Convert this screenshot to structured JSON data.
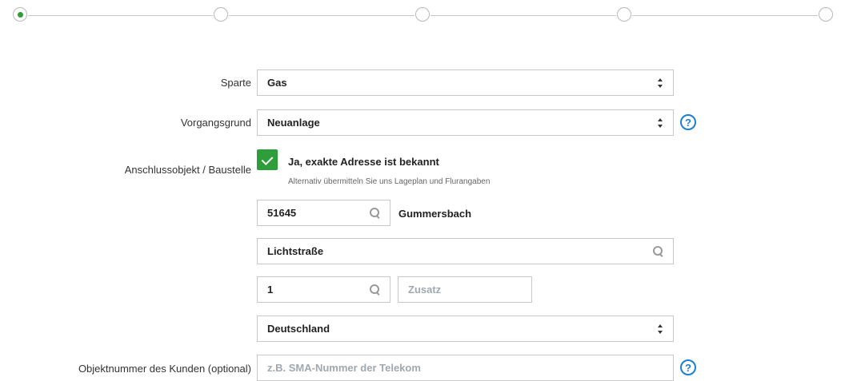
{
  "stepper": {
    "current_step": 1,
    "total_steps": 5
  },
  "sparte": {
    "label": "Sparte",
    "value": "Gas"
  },
  "vorgangsgrund": {
    "label": "Vorgangsgrund",
    "value": "Neuanlage"
  },
  "anschlussobjekt": {
    "label": "Anschlussobjekt / Baustelle",
    "checkbox_label": "Ja, exakte Adresse ist bekannt",
    "checkbox_checked": true,
    "hint": "Alternativ übermitteln Sie uns Lageplan und Flurangaben"
  },
  "plz": {
    "value": "51645",
    "city": "Gummersbach"
  },
  "strasse": {
    "value": "Lichtstraße"
  },
  "hausnummer": {
    "value": "1"
  },
  "zusatz": {
    "placeholder": "Zusatz"
  },
  "land": {
    "value": "Deutschland"
  },
  "objektnummer": {
    "label": "Objektnummer des Kunden (optional)",
    "placeholder": "z.B. SMA-Nummer der Telekom"
  },
  "help_icon_glyph": "?",
  "colors": {
    "accent_green": "#2e9e3a",
    "help_blue": "#1d7fd1",
    "border": "#c8c8c8"
  },
  "icons": [
    "sort-icon",
    "search-icon",
    "help-icon",
    "check-icon"
  ]
}
